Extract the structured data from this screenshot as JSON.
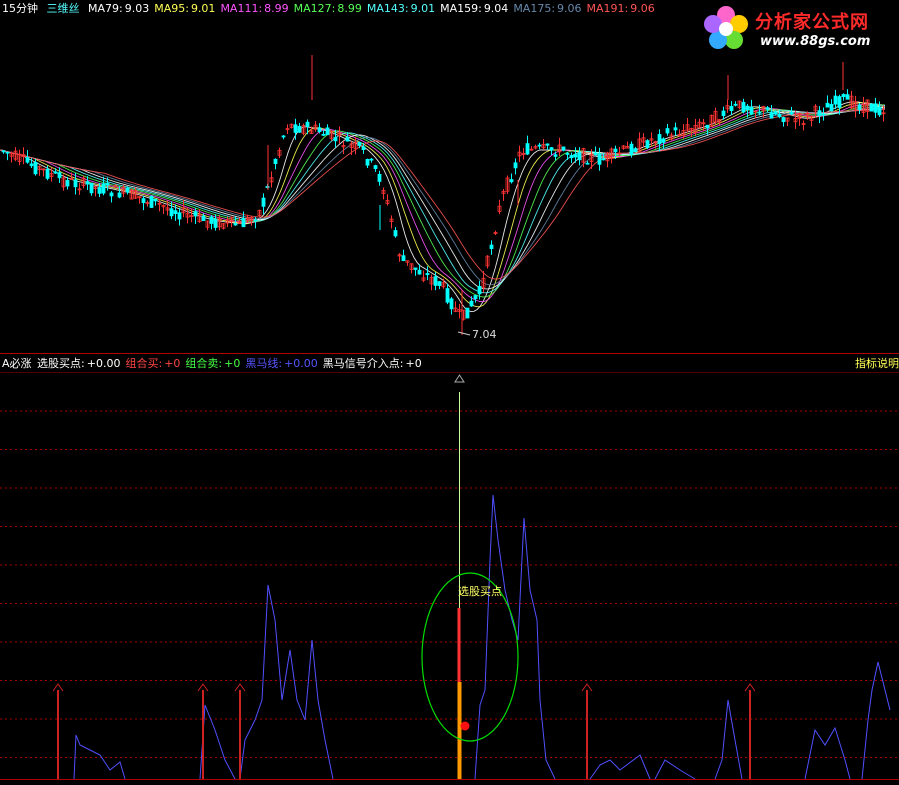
{
  "top_header": {
    "period": "15分钟",
    "indicator": "三维丝",
    "ma": [
      {
        "label": "MA79:",
        "value": "9.03",
        "color": "#ffffff"
      },
      {
        "label": "MA95:",
        "value": "9.01",
        "color": "#ffff55"
      },
      {
        "label": "MA111:",
        "value": "8.99",
        "color": "#ff55ff"
      },
      {
        "label": "MA127:",
        "value": "8.99",
        "color": "#55ff55"
      },
      {
        "label": "MA143:",
        "value": "9.01",
        "color": "#55ffff"
      },
      {
        "label": "MA159:",
        "value": "9.04",
        "color": "#ffffff"
      },
      {
        "label": "MA175:",
        "value": "9.06",
        "color": "#6688aa"
      },
      {
        "label": "MA191:",
        "value": "9.06",
        "color": "#ff5555"
      }
    ]
  },
  "logo": {
    "title": "分析家公式网",
    "url": "www.88gs.com"
  },
  "price_low_label": "7.04",
  "bottom_header": {
    "name": "A必涨",
    "items": [
      {
        "label": "选股买点:",
        "value": "+0.00",
        "color": "#ffffff"
      },
      {
        "label": "组合买:",
        "value": "+0",
        "color": "#ff4444"
      },
      {
        "label": "组合卖:",
        "value": "+0",
        "color": "#44ff44"
      },
      {
        "label": "黑马线:",
        "value": "+0.00",
        "color": "#5555ff"
      },
      {
        "label": "黑马信号介入点:",
        "value": "+0",
        "color": "#ffffff"
      }
    ],
    "help": "指标说明"
  },
  "buy_point_label": "选股买点",
  "colors": {
    "up": "#ff3333",
    "down": "#00ffff",
    "grid": "#aa0000",
    "indicator_line": "#5050ff",
    "signal": "#cc2222",
    "circle": "#00dd00",
    "orange_bar": "#ff9900"
  }
}
